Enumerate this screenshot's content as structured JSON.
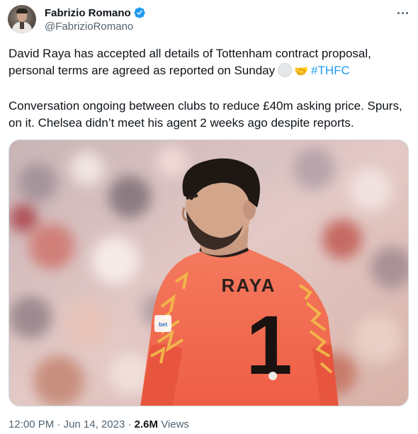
{
  "author": {
    "display_name": "Fabrizio Romano",
    "handle": "@FabrizioRomano",
    "verified": true
  },
  "tweet": {
    "line1_text": "David Raya has accepted all details of Tottenham contract proposal, personal terms are agreed as reported on Sunday",
    "emoji_1": "white-circle-emoji",
    "emoji_2": "🤝",
    "hashtag": "#THFC",
    "paragraph2": "Conversation ongoing between clubs to reduce £40m asking price. Spurs, on it. Chelsea didn’t meet his agent 2 weeks ago despite reports."
  },
  "media": {
    "jersey_name": "RAYA",
    "jersey_number": "1",
    "sponsor_text": "bet",
    "jersey_color": "#f26b4e",
    "pattern_color": "#f2b84b"
  },
  "meta": {
    "time": "12:00 PM",
    "separator": "·",
    "date": "Jun 14, 2023",
    "views_count": "2.6M",
    "views_label": "Views"
  },
  "icons": {
    "verified": "verified-badge-icon",
    "more": "more-options-icon"
  },
  "colors": {
    "link": "#1d9bf0",
    "secondary_text": "#536471",
    "primary_text": "#0f1419",
    "verified": "#1d9bf0"
  }
}
